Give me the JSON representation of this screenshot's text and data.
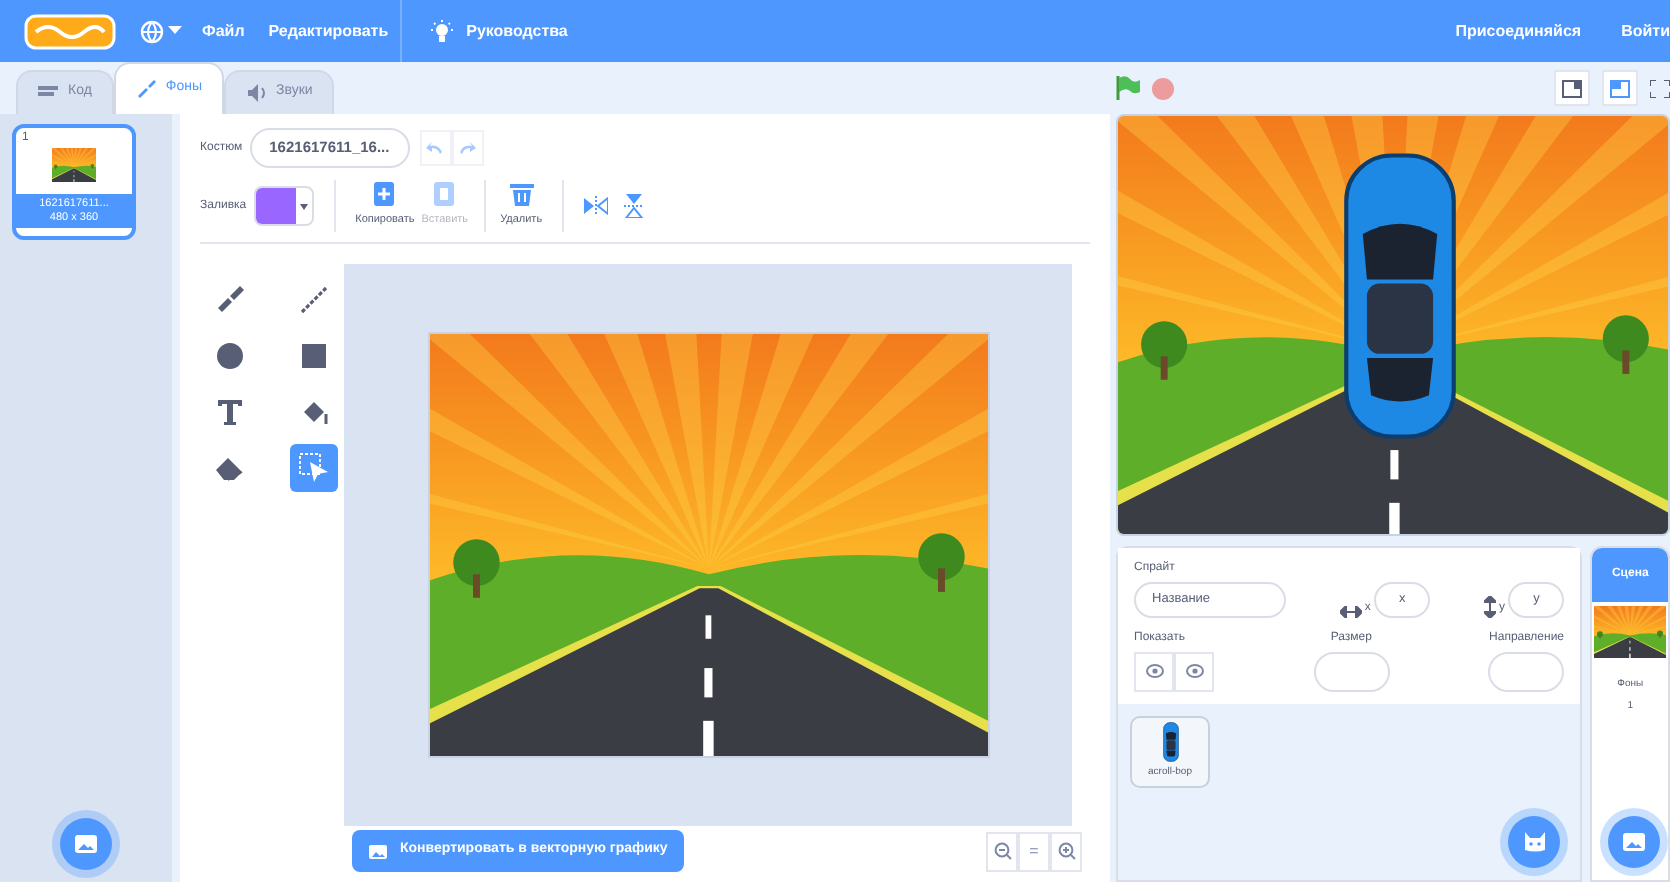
{
  "menubar": {
    "items": [
      {
        "label": "Файл"
      },
      {
        "label": "Редактировать"
      },
      {
        "label": "Руководства"
      }
    ],
    "right_items": [
      {
        "label": "Присоединяйся"
      },
      {
        "label": "Войти"
      }
    ]
  },
  "tabs": [
    {
      "label": "Код",
      "kind": "code",
      "selected": false
    },
    {
      "label": "Фоны",
      "kind": "costumes",
      "selected": true
    },
    {
      "label": "Звуки",
      "kind": "sounds",
      "selected": false
    }
  ],
  "costumes": [
    {
      "number": "1",
      "name": "1621617611...",
      "size": "480 x 360",
      "selected": true
    }
  ],
  "costume_editor": {
    "costume_label": "Костюм",
    "costume_name": "1621617611_16...",
    "fill_label": "Заливка",
    "fill": {
      "color": "#9966ff"
    },
    "history": [
      {
        "kind": "undo",
        "disabled": true
      },
      {
        "kind": "redo",
        "disabled": true
      }
    ],
    "actions": [
      {
        "kind": "copy",
        "label": "Копировать",
        "disabled": false
      },
      {
        "kind": "paste",
        "label": "Вставить",
        "disabled": true
      },
      {
        "kind": "delete",
        "label": "Удалить",
        "disabled": false
      }
    ],
    "flips": [
      {
        "kind": "horizontal"
      },
      {
        "kind": "vertical"
      }
    ],
    "tools": [
      {
        "kind": "brush",
        "selected": false
      },
      {
        "kind": "line",
        "selected": false
      },
      {
        "kind": "circle",
        "selected": false
      },
      {
        "kind": "rectangle",
        "selected": false
      },
      {
        "kind": "text",
        "selected": false
      },
      {
        "kind": "fill",
        "selected": false
      },
      {
        "kind": "eraser",
        "selected": false
      },
      {
        "kind": "select",
        "selected": true
      }
    ],
    "convert_button": "Конвертировать в векторную графику",
    "zoom_reset": "="
  },
  "sprite_info": {
    "sprite_label": "Спрайт",
    "name_placeholder": "Название",
    "x_label": "x",
    "x_placeholder": "x",
    "y_label": "y",
    "y_placeholder": "y",
    "show_label": "Показать",
    "size_label": "Размер",
    "direction_label": "Направление"
  },
  "sprites": [
    {
      "name": "acroll-bop",
      "selected": false
    }
  ],
  "stage_panel": {
    "title": "Сцена",
    "backdrops_label": "Фоны",
    "backdrops_count": "1"
  }
}
